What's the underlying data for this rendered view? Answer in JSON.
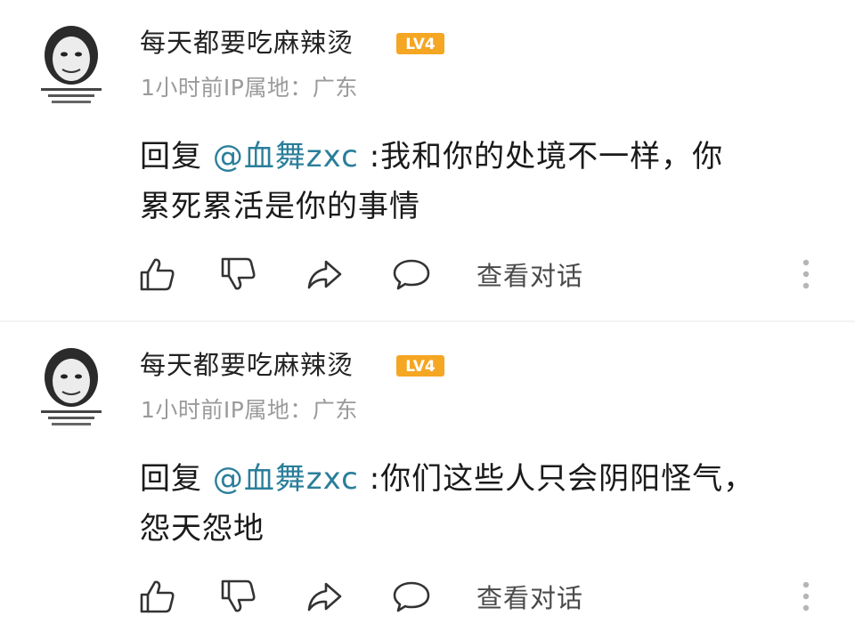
{
  "comments": [
    {
      "username": "每天都要吃麻辣烫",
      "level": "LV4",
      "time": "1小时前",
      "ip_label": "IP属地：广东",
      "reply_prefix": "回复 ",
      "mention": "@血舞zxc",
      "text_line1": " :我和你的处境不一样，你",
      "text_line2": "累死累活是你的事情",
      "view_thread": "查看对话"
    },
    {
      "username": "每天都要吃麻辣烫",
      "level": "LV4",
      "time": "1小时前",
      "ip_label": "IP属地：广东",
      "reply_prefix": "回复 ",
      "mention": "@血舞zxc",
      "text_line1": " :你们这些人只会阴阳怪气，",
      "text_line2": "怨天怨地",
      "view_thread": "查看对话"
    }
  ],
  "colors": {
    "mention": "#2a7e9a",
    "level_badge": "#f5a623",
    "meta": "#9a9a9a"
  },
  "icons": [
    "avatar-meme-face",
    "thumbs-up-icon",
    "thumbs-down-icon",
    "share-icon",
    "comment-bubble-icon",
    "more-vertical-icon"
  ]
}
